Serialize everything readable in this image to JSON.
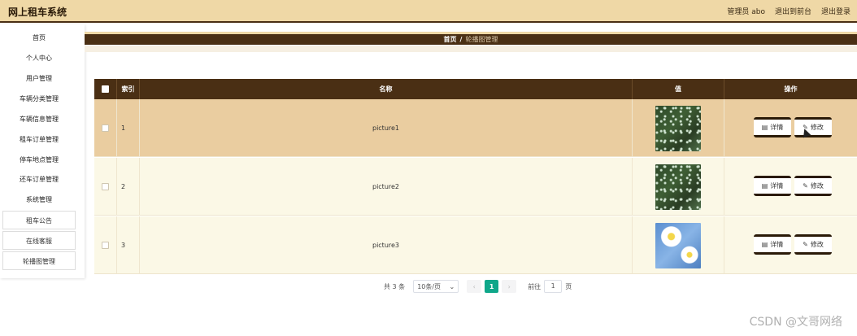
{
  "header": {
    "app_title": "网上租车系统",
    "admin_label": "管理员 abo",
    "exit_front": "退出到前台",
    "logout": "退出登录"
  },
  "sidebar": {
    "items": [
      {
        "label": "首页"
      },
      {
        "label": "个人中心"
      },
      {
        "label": "用户管理"
      },
      {
        "label": "车辆分类管理"
      },
      {
        "label": "车辆信息管理"
      },
      {
        "label": "租车订单管理"
      },
      {
        "label": "停车地点管理"
      },
      {
        "label": "还车订单管理"
      },
      {
        "label": "系统管理"
      }
    ],
    "sub_items": [
      {
        "label": "租车公告"
      },
      {
        "label": "在线客服"
      },
      {
        "label": "轮播图管理"
      }
    ]
  },
  "breadcrumb": {
    "home": "首页",
    "separator": "/",
    "current": "轮播图管理"
  },
  "table": {
    "headers": {
      "index": "索引",
      "name": "名称",
      "value": "值",
      "actions": "操作"
    },
    "rows": [
      {
        "index": "1",
        "name": "picture1",
        "image": "green-leaves"
      },
      {
        "index": "2",
        "name": "picture2",
        "image": "green-leaves"
      },
      {
        "index": "3",
        "name": "picture3",
        "image": "blue-flower"
      }
    ],
    "detail_label": "详情",
    "edit_label": "修改"
  },
  "pagination": {
    "total": "共 3 条",
    "page_size": "10条/页",
    "current_page": "1",
    "goto_label": "前往",
    "goto_value": "1",
    "page_unit": "页"
  },
  "watermark": "CSDN @文哥网络",
  "colors": {
    "brand_dark": "#4a2f14",
    "header_bg": "#efd8a6",
    "row_active": "#eacda0",
    "row_normal": "#fbf8e6",
    "page_active": "#0fa78a"
  }
}
